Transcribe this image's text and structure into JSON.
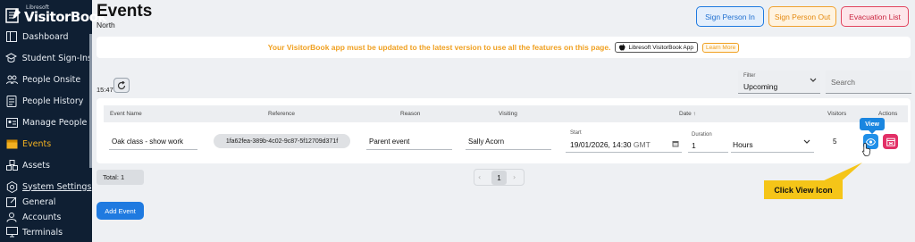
{
  "brand": {
    "small": "Libresoft",
    "name": "VisitorBook"
  },
  "sidebar": {
    "items": [
      {
        "label": "Dashboard",
        "icon": "dashboard-icon"
      },
      {
        "label": "Student Sign-Ins",
        "icon": "student-icon"
      },
      {
        "label": "People Onsite",
        "icon": "people-icon"
      },
      {
        "label": "People History",
        "icon": "history-icon"
      },
      {
        "label": "Manage People",
        "icon": "manage-people-icon"
      },
      {
        "label": "Events",
        "icon": "events-icon",
        "active": true
      },
      {
        "label": "Assets",
        "icon": "assets-icon"
      },
      {
        "label": "System Settings",
        "icon": "settings-icon"
      },
      {
        "label": "General",
        "icon": "edit-icon"
      },
      {
        "label": "Accounts",
        "icon": "accounts-icon"
      },
      {
        "label": "Terminals",
        "icon": "terminals-icon"
      }
    ]
  },
  "header": {
    "title": "Events",
    "subtitle": "North",
    "buttons": {
      "sign_in": "Sign Person In",
      "sign_out": "Sign Person Out",
      "evacuation": "Evacuation List"
    }
  },
  "banner": {
    "text": "Your VisitorBook app must be updated to the latest version to use all the features on this page.",
    "app_chip": "Libresoft VisitorBook App",
    "learn_more": "Learn More"
  },
  "toolbar": {
    "time": "15:47",
    "filter_label": "Filter",
    "filter_value": "Upcoming",
    "search_placeholder": "Search"
  },
  "table": {
    "headers": {
      "event_name": "Event Name",
      "reference": "Reference",
      "reason": "Reason",
      "visiting": "Visiting",
      "date": "Date",
      "visitors": "Visitors",
      "actions": "Actions"
    },
    "row": {
      "event_name": "Oak class - show work",
      "reference": "1fa62fea-389b-4c02-9c87-5f12709d371f",
      "reason": "Parent event",
      "visiting": "Sally Acorn",
      "start_label": "Start",
      "start_value": "19/01/2026, 14:30",
      "timezone": "GMT",
      "duration_label": "Duration",
      "duration_value": "1",
      "duration_unit": "Hours",
      "visitors": "5"
    },
    "tooltip": "View"
  },
  "footer": {
    "total": "Total: 1",
    "page": "1",
    "add_event": "Add Event"
  },
  "callout": "Click View Icon",
  "colors": {
    "sidebar_bg": "#0f1f33",
    "active": "#f2b021",
    "primary": "#1f7ae0",
    "danger": "#e22f66",
    "warning": "#f0a020"
  }
}
